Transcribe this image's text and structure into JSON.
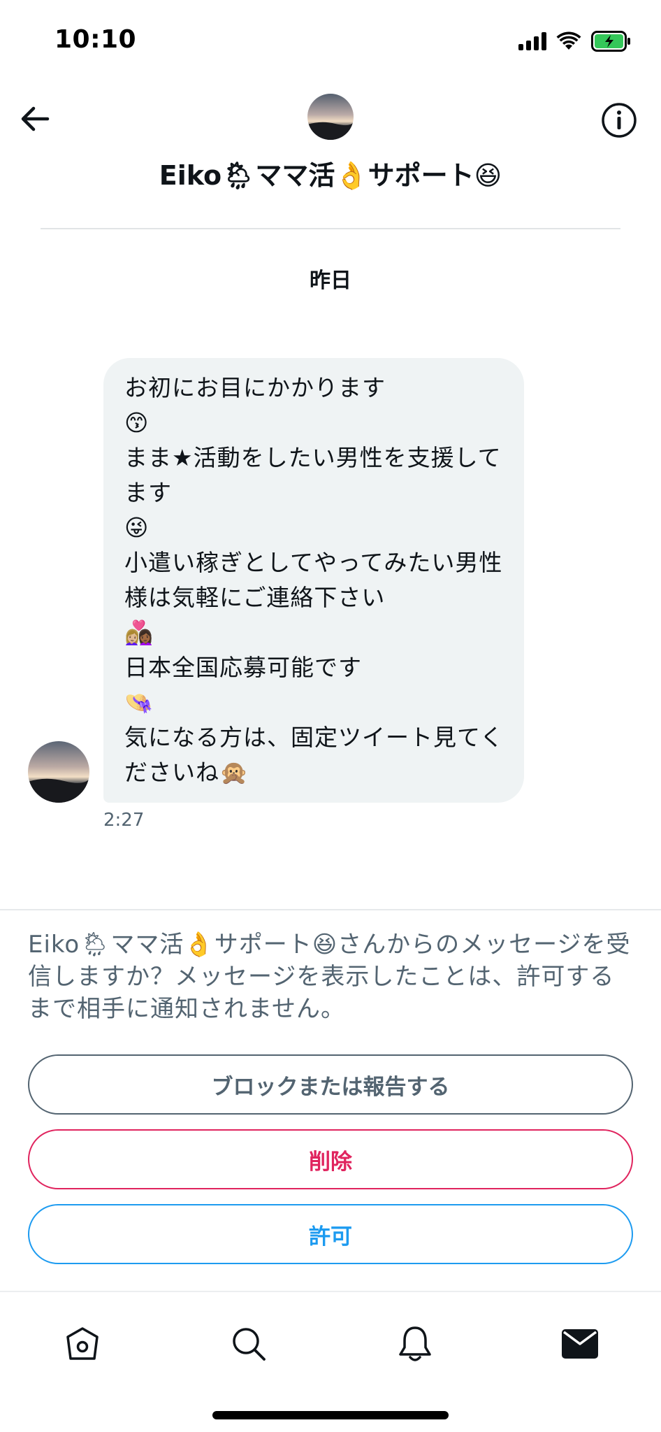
{
  "status_bar": {
    "time": "10:10"
  },
  "header": {
    "contact_name": "Eiko🌦ママ活👌サポート😆",
    "back_icon": "arrow-left-icon",
    "info_icon": "info-circle-icon"
  },
  "conversation": {
    "date_label": "昨日",
    "messages": [
      {
        "text": "お初にお目にかかります\n😙\nまま★活動をしたい男性を支援してます\n😜\n小遣い稼ぎとしてやってみたい男性様は気軽にご連絡下さい\n👩🏼‍❤️‍👩🏾\n日本全国応募可能です\n👒\n気になる方は、固定ツイート見てくださいね🙊",
        "time": "2:27"
      }
    ]
  },
  "request": {
    "prompt": "Eiko🌦ママ活👌サポート😆さんからのメッセージを受信しますか？メッセージを表示したことは、許可するまで相手に通知されません。",
    "block_label": "ブロックまたは報告する",
    "delete_label": "削除",
    "allow_label": "許可"
  },
  "tab_bar": {
    "items": [
      "home-icon",
      "search-icon",
      "bell-icon",
      "mail-icon"
    ],
    "active": "mail-icon"
  },
  "colors": {
    "delete": "#e0245e",
    "allow": "#1d9bf0",
    "secondary_text": "#536471",
    "bubble": "#eff3f4"
  }
}
